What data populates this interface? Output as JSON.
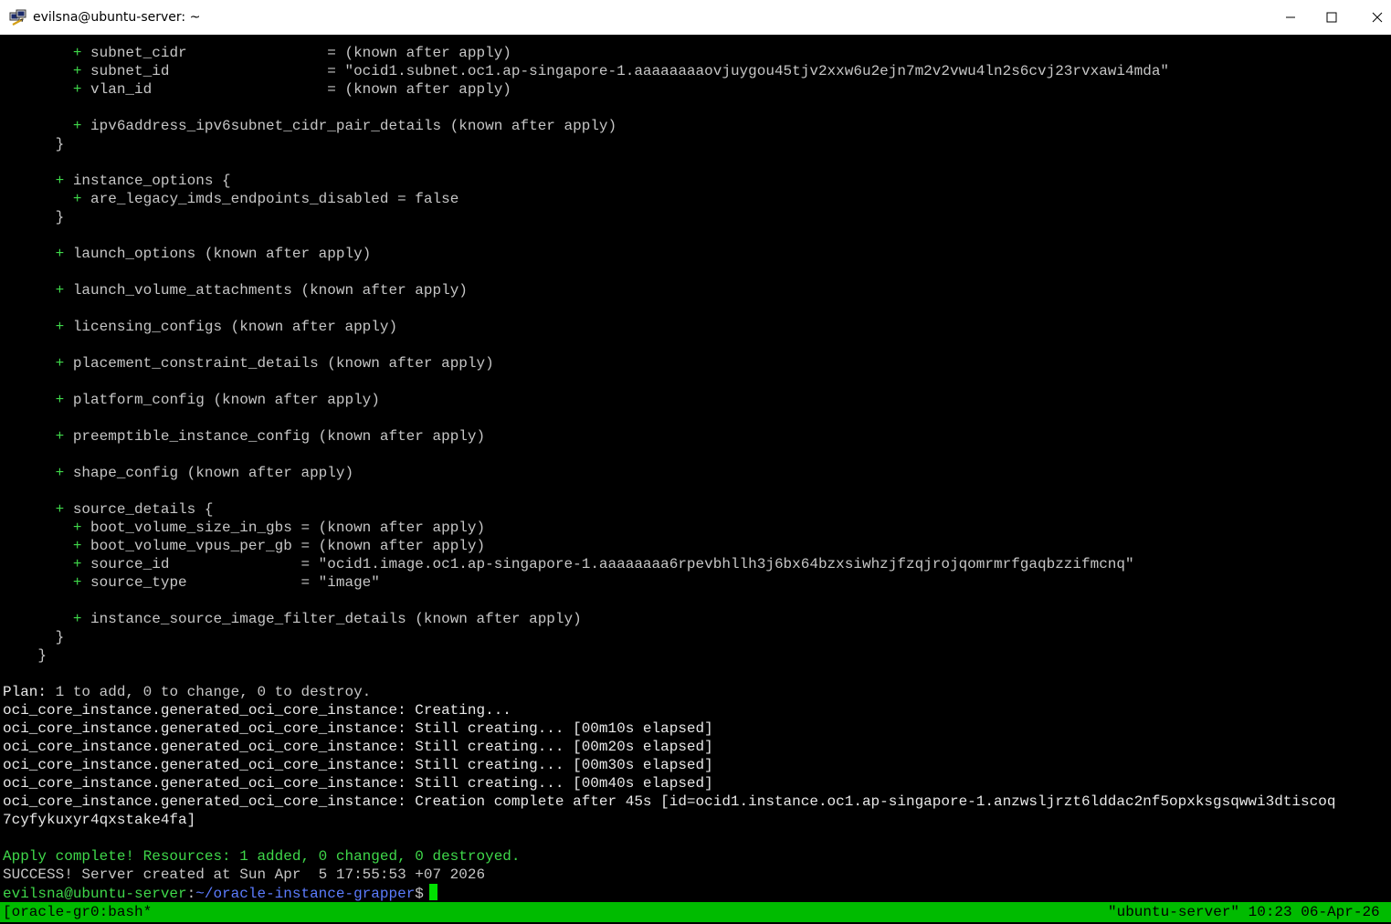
{
  "window": {
    "title": "evilsna@ubuntu-server: ~"
  },
  "terminal": {
    "lines": [
      [
        {
          "t": "        ",
          "c": ""
        },
        {
          "t": "+",
          "c": "g"
        },
        {
          "t": " subnet_cidr                = (known after apply)",
          "c": ""
        }
      ],
      [
        {
          "t": "        ",
          "c": ""
        },
        {
          "t": "+",
          "c": "g"
        },
        {
          "t": " subnet_id                  = \"ocid1.subnet.oc1.ap-singapore-1.aaaaaaaaovjuygou45tjv2xxw6u2ejn7m2v2vwu4ln2s6cvj23rvxawi4mda\"",
          "c": ""
        }
      ],
      [
        {
          "t": "        ",
          "c": ""
        },
        {
          "t": "+",
          "c": "g"
        },
        {
          "t": " vlan_id                    = (known after apply)",
          "c": ""
        }
      ],
      [],
      [
        {
          "t": "        ",
          "c": ""
        },
        {
          "t": "+",
          "c": "g"
        },
        {
          "t": " ipv6address_ipv6subnet_cidr_pair_details (known after apply)",
          "c": ""
        }
      ],
      [
        {
          "t": "      }",
          "c": ""
        }
      ],
      [],
      [
        {
          "t": "      ",
          "c": ""
        },
        {
          "t": "+",
          "c": "g"
        },
        {
          "t": " instance_options {",
          "c": ""
        }
      ],
      [
        {
          "t": "        ",
          "c": ""
        },
        {
          "t": "+",
          "c": "g"
        },
        {
          "t": " are_legacy_imds_endpoints_disabled = false",
          "c": ""
        }
      ],
      [
        {
          "t": "      }",
          "c": ""
        }
      ],
      [],
      [
        {
          "t": "      ",
          "c": ""
        },
        {
          "t": "+",
          "c": "g"
        },
        {
          "t": " launch_options (known after apply)",
          "c": ""
        }
      ],
      [],
      [
        {
          "t": "      ",
          "c": ""
        },
        {
          "t": "+",
          "c": "g"
        },
        {
          "t": " launch_volume_attachments (known after apply)",
          "c": ""
        }
      ],
      [],
      [
        {
          "t": "      ",
          "c": ""
        },
        {
          "t": "+",
          "c": "g"
        },
        {
          "t": " licensing_configs (known after apply)",
          "c": ""
        }
      ],
      [],
      [
        {
          "t": "      ",
          "c": ""
        },
        {
          "t": "+",
          "c": "g"
        },
        {
          "t": " placement_constraint_details (known after apply)",
          "c": ""
        }
      ],
      [],
      [
        {
          "t": "      ",
          "c": ""
        },
        {
          "t": "+",
          "c": "g"
        },
        {
          "t": " platform_config (known after apply)",
          "c": ""
        }
      ],
      [],
      [
        {
          "t": "      ",
          "c": ""
        },
        {
          "t": "+",
          "c": "g"
        },
        {
          "t": " preemptible_instance_config (known after apply)",
          "c": ""
        }
      ],
      [],
      [
        {
          "t": "      ",
          "c": ""
        },
        {
          "t": "+",
          "c": "g"
        },
        {
          "t": " shape_config (known after apply)",
          "c": ""
        }
      ],
      [],
      [
        {
          "t": "      ",
          "c": ""
        },
        {
          "t": "+",
          "c": "g"
        },
        {
          "t": " source_details {",
          "c": ""
        }
      ],
      [
        {
          "t": "        ",
          "c": ""
        },
        {
          "t": "+",
          "c": "g"
        },
        {
          "t": " boot_volume_size_in_gbs = (known after apply)",
          "c": ""
        }
      ],
      [
        {
          "t": "        ",
          "c": ""
        },
        {
          "t": "+",
          "c": "g"
        },
        {
          "t": " boot_volume_vpus_per_gb = (known after apply)",
          "c": ""
        }
      ],
      [
        {
          "t": "        ",
          "c": ""
        },
        {
          "t": "+",
          "c": "g"
        },
        {
          "t": " source_id               = \"ocid1.image.oc1.ap-singapore-1.aaaaaaaa6rpevbhllh3j6bx64bzxsiwhzjfzqjrojqomrmrfgaqbzzifmcnq\"",
          "c": ""
        }
      ],
      [
        {
          "t": "        ",
          "c": ""
        },
        {
          "t": "+",
          "c": "g"
        },
        {
          "t": " source_type             = \"image\"",
          "c": ""
        }
      ],
      [],
      [
        {
          "t": "        ",
          "c": ""
        },
        {
          "t": "+",
          "c": "g"
        },
        {
          "t": " instance_source_image_filter_details (known after apply)",
          "c": ""
        }
      ],
      [
        {
          "t": "      }",
          "c": ""
        }
      ],
      [
        {
          "t": "    }",
          "c": ""
        }
      ],
      [],
      [
        {
          "t": "Plan:",
          "c": "w"
        },
        {
          "t": " 1 to add, 0 to change, 0 to destroy.",
          "c": ""
        }
      ],
      [
        {
          "t": "oci_core_instance.generated_oci_core_instance: Creating...",
          "c": "w"
        }
      ],
      [
        {
          "t": "oci_core_instance.generated_oci_core_instance: Still creating... [00m10s elapsed]",
          "c": "w"
        }
      ],
      [
        {
          "t": "oci_core_instance.generated_oci_core_instance: Still creating... [00m20s elapsed]",
          "c": "w"
        }
      ],
      [
        {
          "t": "oci_core_instance.generated_oci_core_instance: Still creating... [00m30s elapsed]",
          "c": "w"
        }
      ],
      [
        {
          "t": "oci_core_instance.generated_oci_core_instance: Still creating... [00m40s elapsed]",
          "c": "w"
        }
      ],
      [
        {
          "t": "oci_core_instance.generated_oci_core_instance: Creation complete after 45s [id=ocid1.instance.oc1.ap-singapore-1.anzwsljrzt6lddac2nf5opxksgsqwwi3dtiscoq",
          "c": "w"
        }
      ],
      [
        {
          "t": "7cyfykuxyr4qxstake4fa]",
          "c": "w"
        }
      ],
      [],
      [
        {
          "t": "Apply complete! Resources: 1 added, 0 changed, 0 destroyed.",
          "c": "g"
        }
      ],
      [
        {
          "t": "SUCCESS! Server created at Sun Apr  5 17:55:53 +07 2026",
          "c": ""
        }
      ]
    ],
    "prompt": {
      "user_host": "evilsna@ubuntu-server",
      "sep": ":",
      "path": "~/oracle-instance-grapper",
      "symbol": "$"
    }
  },
  "statusbar": {
    "left": "[oracle-gr0:bash*",
    "right": "\"ubuntu-server\" 10:23 06-Apr-26"
  },
  "colors": {
    "terminal_bg": "#000000",
    "terminal_fg": "#c6c6c6",
    "plus_green": "#3fd84a",
    "path_blue": "#5c7cff",
    "statusbar_green": "#00bb00",
    "cursor_green": "#00e000"
  },
  "icons": {
    "app": "putty-icon",
    "minimize": "minimize-icon",
    "maximize": "maximize-icon",
    "close": "close-icon"
  }
}
